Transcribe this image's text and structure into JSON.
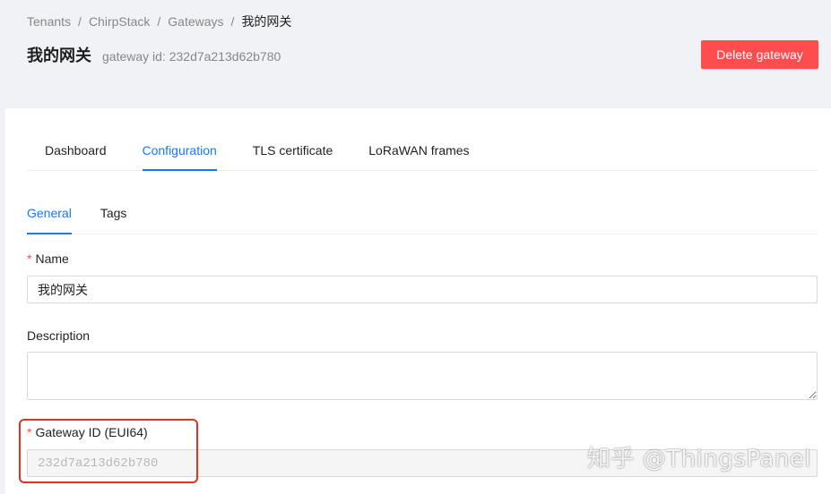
{
  "breadcrumb": {
    "items": [
      "Tenants",
      "ChirpStack",
      "Gateways",
      "我的网关"
    ],
    "separator": "/"
  },
  "header": {
    "title": "我的网关",
    "subtitle": "gateway id: 232d7a213d62b780",
    "delete_label": "Delete gateway"
  },
  "tabs": [
    {
      "label": "Dashboard",
      "active": false
    },
    {
      "label": "Configuration",
      "active": true
    },
    {
      "label": "TLS certificate",
      "active": false
    },
    {
      "label": "LoRaWAN frames",
      "active": false
    }
  ],
  "subtabs": [
    {
      "label": "General",
      "active": true
    },
    {
      "label": "Tags",
      "active": false
    }
  ],
  "form": {
    "name": {
      "label": "Name",
      "required": "*",
      "value": "我的网关"
    },
    "description": {
      "label": "Description",
      "value": ""
    },
    "gateway_id": {
      "label": "Gateway ID (EUI64)",
      "required": "*",
      "value": "232d7a213d62b780"
    }
  },
  "watermark": "知乎 @ThingsPanel",
  "colors": {
    "primary": "#1677ff",
    "danger": "#ff4d4f",
    "highlight": "#e0341f",
    "background": "#f0f2f5"
  }
}
